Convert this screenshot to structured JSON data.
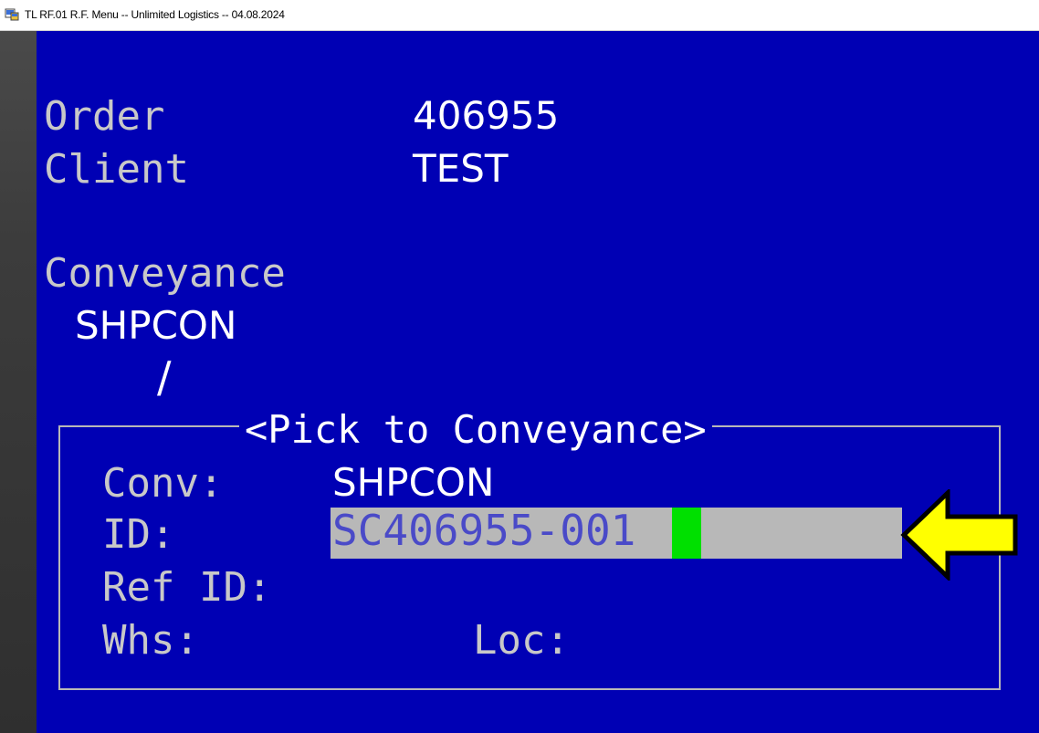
{
  "window": {
    "title": "TL RF.01 R.F. Menu -- Unlimited Logistics -- 04.08.2024",
    "icon": "app-terminal-icon"
  },
  "header": {
    "order_label": "Order",
    "order_value": "406955",
    "client_label": "Client",
    "client_value": "TEST"
  },
  "conveyance": {
    "label": "Conveyance",
    "value": "SHPCON",
    "separator": "/"
  },
  "dialog": {
    "title": "<Pick to Conveyance>",
    "conv_label": "Conv:",
    "conv_value": "SHPCON",
    "id_label": "ID:",
    "id_value": "SC406955-001",
    "ref_id_label": "Ref ID:",
    "whs_label": "Whs:",
    "loc_label": "Loc:"
  },
  "colors": {
    "terminal_bg": "#0000b4",
    "field_bg": "#b8b8b8",
    "cursor": "#00e000",
    "arrow": "#ffff00"
  }
}
